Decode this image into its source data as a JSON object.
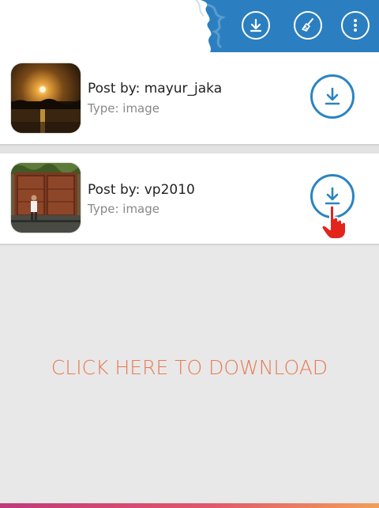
{
  "toolbar": {
    "buttons": [
      {
        "name": "download-all-button",
        "icon": "download-icon"
      },
      {
        "name": "clear-button",
        "icon": "broom-icon"
      },
      {
        "name": "more-options-button",
        "icon": "more-vertical-icon"
      }
    ],
    "accent_color": "#2b84c2"
  },
  "posts": [
    {
      "post_by": "Post by: mayur_jaka",
      "type": "Type: image",
      "thumb": "sunset-lake-photo",
      "icon": "download-icon"
    },
    {
      "post_by": "Post by: vp2010",
      "type": "Type: image",
      "thumb": "man-at-wooden-gate-photo",
      "icon": "download-icon"
    }
  ],
  "cta": {
    "label": "CLICK HERE TO DOWNLOAD",
    "color": "#e87a52"
  },
  "cursor_icon": "pointing-hand-icon"
}
